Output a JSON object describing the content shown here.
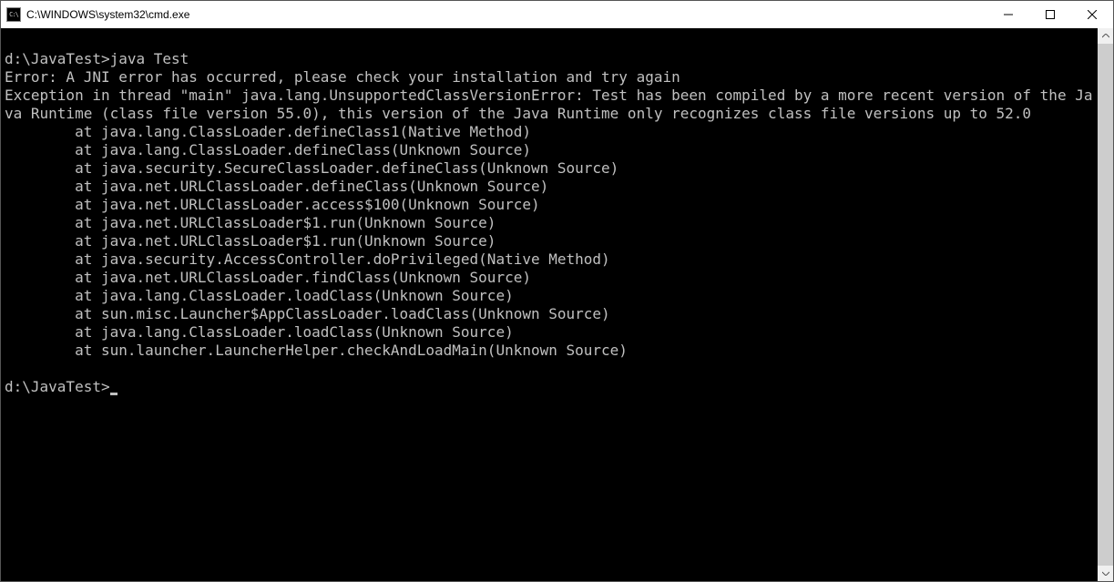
{
  "window": {
    "title": "C:\\WINDOWS\\system32\\cmd.exe",
    "icon_label": "C:\\"
  },
  "terminal": {
    "prompt1": "d:\\JavaTest>",
    "command1": "java Test",
    "error_line": "Error: A JNI error has occurred, please check your installation and try again",
    "exception_line": "Exception in thread \"main\" java.lang.UnsupportedClassVersionError: Test has been compiled by a more recent version of the Java Runtime (class file version 55.0), this version of the Java Runtime only recognizes class file versions up to 52.0",
    "stack": [
      "        at java.lang.ClassLoader.defineClass1(Native Method)",
      "        at java.lang.ClassLoader.defineClass(Unknown Source)",
      "        at java.security.SecureClassLoader.defineClass(Unknown Source)",
      "        at java.net.URLClassLoader.defineClass(Unknown Source)",
      "        at java.net.URLClassLoader.access$100(Unknown Source)",
      "        at java.net.URLClassLoader$1.run(Unknown Source)",
      "        at java.net.URLClassLoader$1.run(Unknown Source)",
      "        at java.security.AccessController.doPrivileged(Native Method)",
      "        at java.net.URLClassLoader.findClass(Unknown Source)",
      "        at java.lang.ClassLoader.loadClass(Unknown Source)",
      "        at sun.misc.Launcher$AppClassLoader.loadClass(Unknown Source)",
      "        at java.lang.ClassLoader.loadClass(Unknown Source)",
      "        at sun.launcher.LauncherHelper.checkAndLoadMain(Unknown Source)"
    ],
    "prompt2": "d:\\JavaTest>"
  }
}
